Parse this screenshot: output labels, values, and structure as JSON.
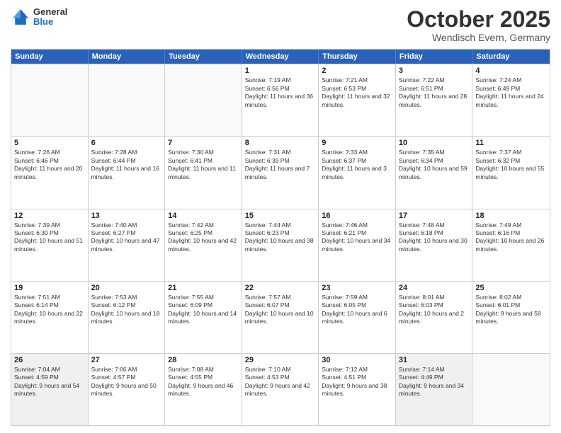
{
  "header": {
    "logo_general": "General",
    "logo_blue": "Blue",
    "month": "October 2025",
    "location": "Wendisch Evern, Germany"
  },
  "days_of_week": [
    "Sunday",
    "Monday",
    "Tuesday",
    "Wednesday",
    "Thursday",
    "Friday",
    "Saturday"
  ],
  "weeks": [
    [
      {
        "day": "",
        "info": ""
      },
      {
        "day": "",
        "info": ""
      },
      {
        "day": "",
        "info": ""
      },
      {
        "day": "1",
        "info": "Sunrise: 7:19 AM\nSunset: 6:56 PM\nDaylight: 11 hours and 36 minutes."
      },
      {
        "day": "2",
        "info": "Sunrise: 7:21 AM\nSunset: 6:53 PM\nDaylight: 11 hours and 32 minutes."
      },
      {
        "day": "3",
        "info": "Sunrise: 7:22 AM\nSunset: 6:51 PM\nDaylight: 11 hours and 28 minutes."
      },
      {
        "day": "4",
        "info": "Sunrise: 7:24 AM\nSunset: 6:49 PM\nDaylight: 11 hours and 24 minutes."
      }
    ],
    [
      {
        "day": "5",
        "info": "Sunrise: 7:26 AM\nSunset: 6:46 PM\nDaylight: 11 hours and 20 minutes."
      },
      {
        "day": "6",
        "info": "Sunrise: 7:28 AM\nSunset: 6:44 PM\nDaylight: 11 hours and 16 minutes."
      },
      {
        "day": "7",
        "info": "Sunrise: 7:30 AM\nSunset: 6:41 PM\nDaylight: 11 hours and 11 minutes."
      },
      {
        "day": "8",
        "info": "Sunrise: 7:31 AM\nSunset: 6:39 PM\nDaylight: 11 hours and 7 minutes."
      },
      {
        "day": "9",
        "info": "Sunrise: 7:33 AM\nSunset: 6:37 PM\nDaylight: 11 hours and 3 minutes."
      },
      {
        "day": "10",
        "info": "Sunrise: 7:35 AM\nSunset: 6:34 PM\nDaylight: 10 hours and 59 minutes."
      },
      {
        "day": "11",
        "info": "Sunrise: 7:37 AM\nSunset: 6:32 PM\nDaylight: 10 hours and 55 minutes."
      }
    ],
    [
      {
        "day": "12",
        "info": "Sunrise: 7:39 AM\nSunset: 6:30 PM\nDaylight: 10 hours and 51 minutes."
      },
      {
        "day": "13",
        "info": "Sunrise: 7:40 AM\nSunset: 6:27 PM\nDaylight: 10 hours and 47 minutes."
      },
      {
        "day": "14",
        "info": "Sunrise: 7:42 AM\nSunset: 6:25 PM\nDaylight: 10 hours and 42 minutes."
      },
      {
        "day": "15",
        "info": "Sunrise: 7:44 AM\nSunset: 6:23 PM\nDaylight: 10 hours and 38 minutes."
      },
      {
        "day": "16",
        "info": "Sunrise: 7:46 AM\nSunset: 6:21 PM\nDaylight: 10 hours and 34 minutes."
      },
      {
        "day": "17",
        "info": "Sunrise: 7:48 AM\nSunset: 6:18 PM\nDaylight: 10 hours and 30 minutes."
      },
      {
        "day": "18",
        "info": "Sunrise: 7:49 AM\nSunset: 6:16 PM\nDaylight: 10 hours and 26 minutes."
      }
    ],
    [
      {
        "day": "19",
        "info": "Sunrise: 7:51 AM\nSunset: 6:14 PM\nDaylight: 10 hours and 22 minutes."
      },
      {
        "day": "20",
        "info": "Sunrise: 7:53 AM\nSunset: 6:12 PM\nDaylight: 10 hours and 18 minutes."
      },
      {
        "day": "21",
        "info": "Sunrise: 7:55 AM\nSunset: 6:09 PM\nDaylight: 10 hours and 14 minutes."
      },
      {
        "day": "22",
        "info": "Sunrise: 7:57 AM\nSunset: 6:07 PM\nDaylight: 10 hours and 10 minutes."
      },
      {
        "day": "23",
        "info": "Sunrise: 7:59 AM\nSunset: 6:05 PM\nDaylight: 10 hours and 6 minutes."
      },
      {
        "day": "24",
        "info": "Sunrise: 8:01 AM\nSunset: 6:03 PM\nDaylight: 10 hours and 2 minutes."
      },
      {
        "day": "25",
        "info": "Sunrise: 8:02 AM\nSunset: 6:01 PM\nDaylight: 9 hours and 58 minutes."
      }
    ],
    [
      {
        "day": "26",
        "info": "Sunrise: 7:04 AM\nSunset: 4:59 PM\nDaylight: 9 hours and 54 minutes."
      },
      {
        "day": "27",
        "info": "Sunrise: 7:06 AM\nSunset: 4:57 PM\nDaylight: 9 hours and 50 minutes."
      },
      {
        "day": "28",
        "info": "Sunrise: 7:08 AM\nSunset: 4:55 PM\nDaylight: 9 hours and 46 minutes."
      },
      {
        "day": "29",
        "info": "Sunrise: 7:10 AM\nSunset: 4:53 PM\nDaylight: 9 hours and 42 minutes."
      },
      {
        "day": "30",
        "info": "Sunrise: 7:12 AM\nSunset: 4:51 PM\nDaylight: 9 hours and 38 minutes."
      },
      {
        "day": "31",
        "info": "Sunrise: 7:14 AM\nSunset: 4:49 PM\nDaylight: 9 hours and 34 minutes."
      },
      {
        "day": "",
        "info": ""
      }
    ]
  ]
}
